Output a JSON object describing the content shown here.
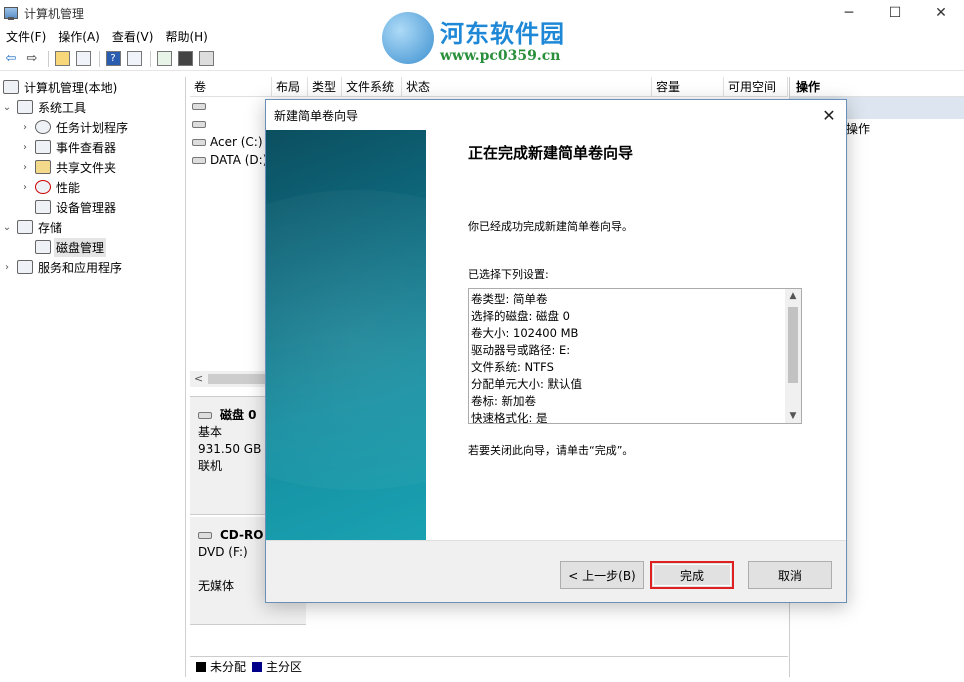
{
  "window": {
    "title": "计算机管理",
    "minimize": "─",
    "maximize": "☐",
    "close": "✕"
  },
  "logo": {
    "title": "河东软件园",
    "url": "www.pc0359.cn"
  },
  "menu": [
    "文件(F)",
    "操作(A)",
    "查看(V)",
    "帮助(H)"
  ],
  "toolbar": {
    "back": "⇦",
    "forward": "⇨",
    "help": "?"
  },
  "tree": {
    "root": "计算机管理(本地)",
    "system_tools": "系统工具",
    "task_scheduler": "任务计划程序",
    "event_viewer": "事件查看器",
    "shared_folders": "共享文件夹",
    "performance": "性能",
    "device_manager": "设备管理器",
    "storage": "存储",
    "disk_management": "磁盘管理",
    "services": "服务和应用程序"
  },
  "volumes": {
    "headers": [
      "卷",
      "布局",
      "类型",
      "文件系统",
      "状态",
      "容量",
      "可用空间"
    ],
    "rows": [
      "",
      "",
      "Acer (C:)",
      "DATA (D:)"
    ],
    "scroll_left": "<"
  },
  "disks": [
    {
      "name": "磁盘 0",
      "type": "基本",
      "size": "931.50 GB",
      "status": "联机"
    },
    {
      "name": "CD-RO",
      "type": "DVD (F:)",
      "size": "",
      "status": "无媒体"
    }
  ],
  "legend": [
    {
      "label": "未分配",
      "color": "#000000"
    },
    {
      "label": "主分区",
      "color": "#00008b"
    }
  ],
  "actions": {
    "header": "操作",
    "item": "操作"
  },
  "dialog": {
    "title": "新建简单卷向导",
    "close": "✕",
    "heading": "正在完成新建简单卷向导",
    "intro": "你已经成功完成新建简单卷向导。",
    "settings_label": "已选择下列设置:",
    "settings": [
      "卷类型: 简单卷",
      "选择的磁盘: 磁盘 0",
      "卷大小: 102400 MB",
      "驱动器号或路径: E:",
      "文件系统: NTFS",
      "分配单元大小: 默认值",
      "卷标: 新加卷",
      "快速格式化: 是"
    ],
    "close_hint": "若要关闭此向导，请单击“完成”。",
    "back_button": "< 上一步(B)",
    "finish_button": "完成",
    "cancel_button": "取消"
  }
}
